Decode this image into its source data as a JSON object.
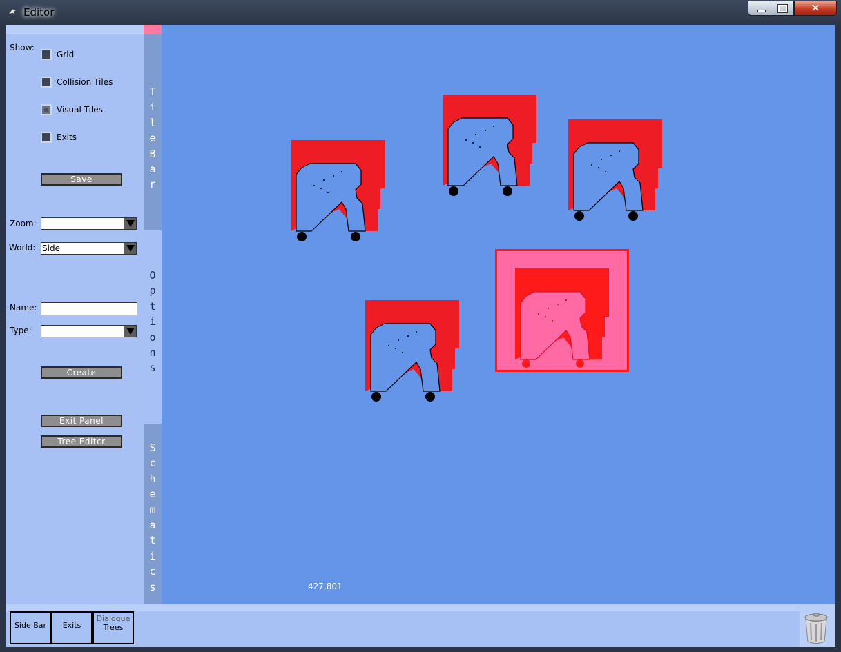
{
  "window": {
    "title": "Editor"
  },
  "titlebar": {
    "close_label": "✕"
  },
  "sidebar": {
    "show_label": "Show:",
    "checkboxes": [
      {
        "label": "Grid",
        "checked": false
      },
      {
        "label": "Collision Tiles",
        "checked": false
      },
      {
        "label": "Visual Tiles",
        "checked": true
      },
      {
        "label": "Exits",
        "checked": false
      }
    ],
    "save_label": "Save",
    "zoom_label": "Zoom:",
    "zoom_value": "",
    "world_label": "World:",
    "world_value": "Side",
    "name_label": "Name:",
    "name_value": "",
    "type_label": "Type:",
    "type_value": "",
    "create_label": "Create",
    "exit_panel_label": "Exit Panel",
    "tree_editor_label": "Tree Editcr"
  },
  "tabs": {
    "tile_bar": "TileBar",
    "options": "Options",
    "schematics": "Schematics"
  },
  "canvas": {
    "coordinates": "427,801",
    "colors": {
      "background": "#6495e9",
      "sprite_red": "#ee1c24",
      "selection_pink": "#ff69a4"
    }
  },
  "bottom_tabs": [
    {
      "label": "Side Bar"
    },
    {
      "label": "Exits"
    },
    {
      "label": "Dialogue Trees",
      "line1": "Dialogue",
      "line2": "Trees"
    }
  ],
  "icons": {
    "app": "dragon-app-icon",
    "trash": "trash-can-icon"
  }
}
